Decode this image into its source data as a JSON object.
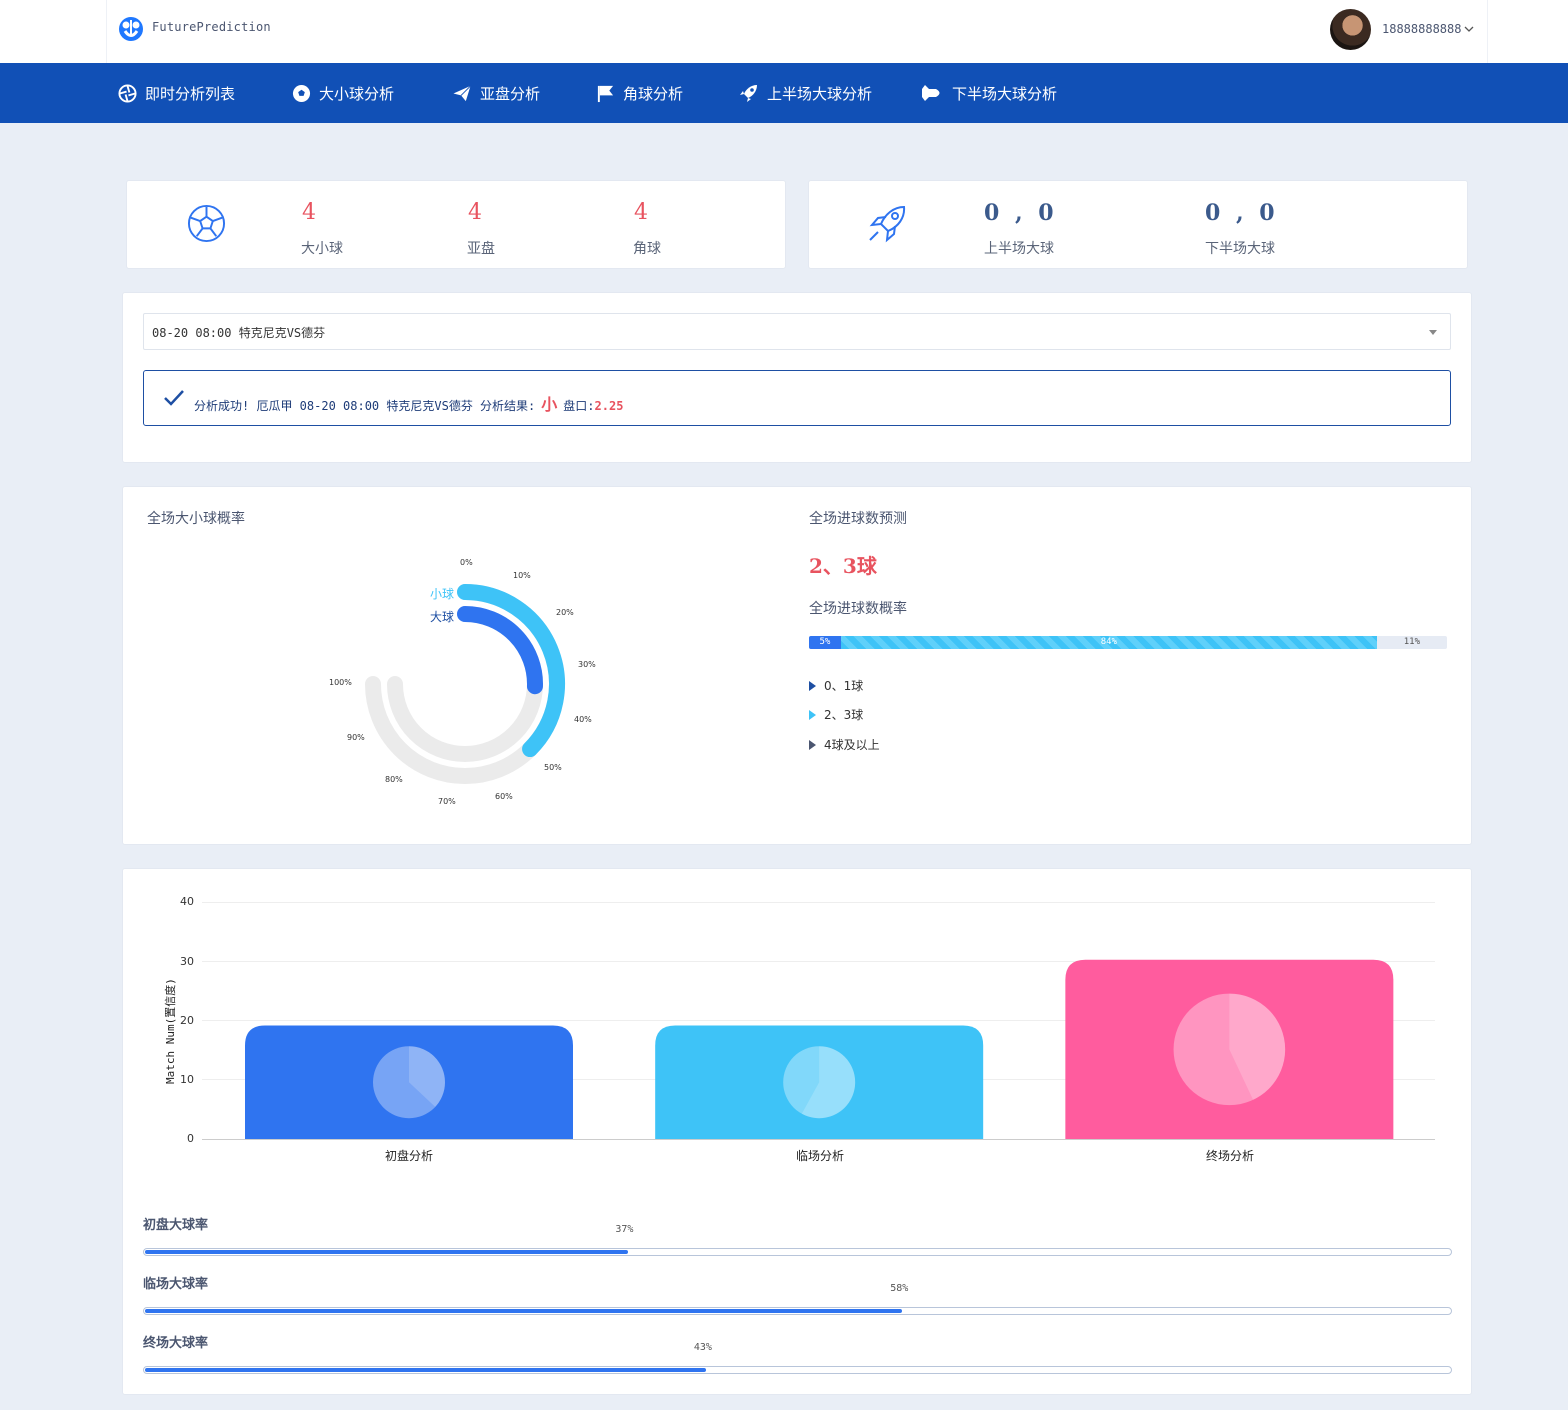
{
  "header": {
    "brand": "FuturePrediction",
    "username": "18888888888",
    "icons": [
      "logo-icon",
      "avatar",
      "chevron-down-icon"
    ]
  },
  "nav": [
    {
      "label": "即时分析列表",
      "icon": "aperture-icon"
    },
    {
      "label": "大小球分析",
      "icon": "soccer-ball-icon"
    },
    {
      "label": "亚盘分析",
      "icon": "paper-plane-icon"
    },
    {
      "label": "角球分析",
      "icon": "flag-icon"
    },
    {
      "label": "上半场大球分析",
      "icon": "rocket-icon"
    },
    {
      "label": "下半场大球分析",
      "icon": "shuttle-icon"
    }
  ],
  "stats_left": {
    "icon": "soccer-ball-icon",
    "items": [
      {
        "value": "4",
        "label": "大小球"
      },
      {
        "value": "4",
        "label": "亚盘"
      },
      {
        "value": "4",
        "label": "角球"
      }
    ]
  },
  "stats_right": {
    "icon": "rocket-icon",
    "items": [
      {
        "value": "0 , 0",
        "label": "上半场大球"
      },
      {
        "value": "0 , 0",
        "label": "下半场大球"
      }
    ]
  },
  "match_select": {
    "value": "08-20 08:00 特克尼克VS德芬"
  },
  "alert": {
    "prefix": "分析成功! 厄瓜甲 08-20 08:00 特克尼克VS德芬 分析结果:",
    "result": "小",
    "odds_label": "盘口:",
    "odds_value": "2.25",
    "color": "#1e4fa3"
  },
  "dial": {
    "title": "全场大小球概率",
    "ticks": [
      "0%",
      "10%",
      "20%",
      "30%",
      "40%",
      "50%",
      "60%",
      "70%",
      "80%",
      "90%",
      "100%"
    ],
    "series": [
      {
        "name": "小球",
        "value": 50,
        "color": "#3ec3f7"
      },
      {
        "name": "大球",
        "value": 34,
        "color": "#2f74f0"
      }
    ]
  },
  "goals": {
    "title": "全场进球数预测",
    "prediction": "2、3球",
    "rate_title": "全场进球数概率",
    "segments": [
      {
        "label": "5%",
        "value": 5
      },
      {
        "label": "84%",
        "value": 84
      },
      {
        "label": "11%",
        "value": 11
      }
    ],
    "legend": [
      "0、1球",
      "2、3球",
      "4球及以上"
    ],
    "legend_colors": [
      "#1e4fa3",
      "#3ec3f7",
      "#4b5670"
    ]
  },
  "chart_data": {
    "type": "bar",
    "categories": [
      "初盘分析",
      "临场分析",
      "终场分析"
    ],
    "values": [
      19,
      19,
      30
    ],
    "colors": [
      "#2f74f0",
      "#3ec3f7",
      "#ff5c9e"
    ],
    "ylabel": "Match Num(置信度)",
    "ylim": [
      0,
      40
    ],
    "yticks": [
      "0",
      "10",
      "20",
      "30",
      "40"
    ],
    "inner_pie_fraction": [
      0.37,
      0.58,
      0.43
    ]
  },
  "rates": [
    {
      "title": "初盘大球率",
      "value": 37,
      "label": "37%"
    },
    {
      "title": "临场大球率",
      "value": 58,
      "label": "58%"
    },
    {
      "title": "终场大球率",
      "value": 43,
      "label": "43%"
    }
  ]
}
